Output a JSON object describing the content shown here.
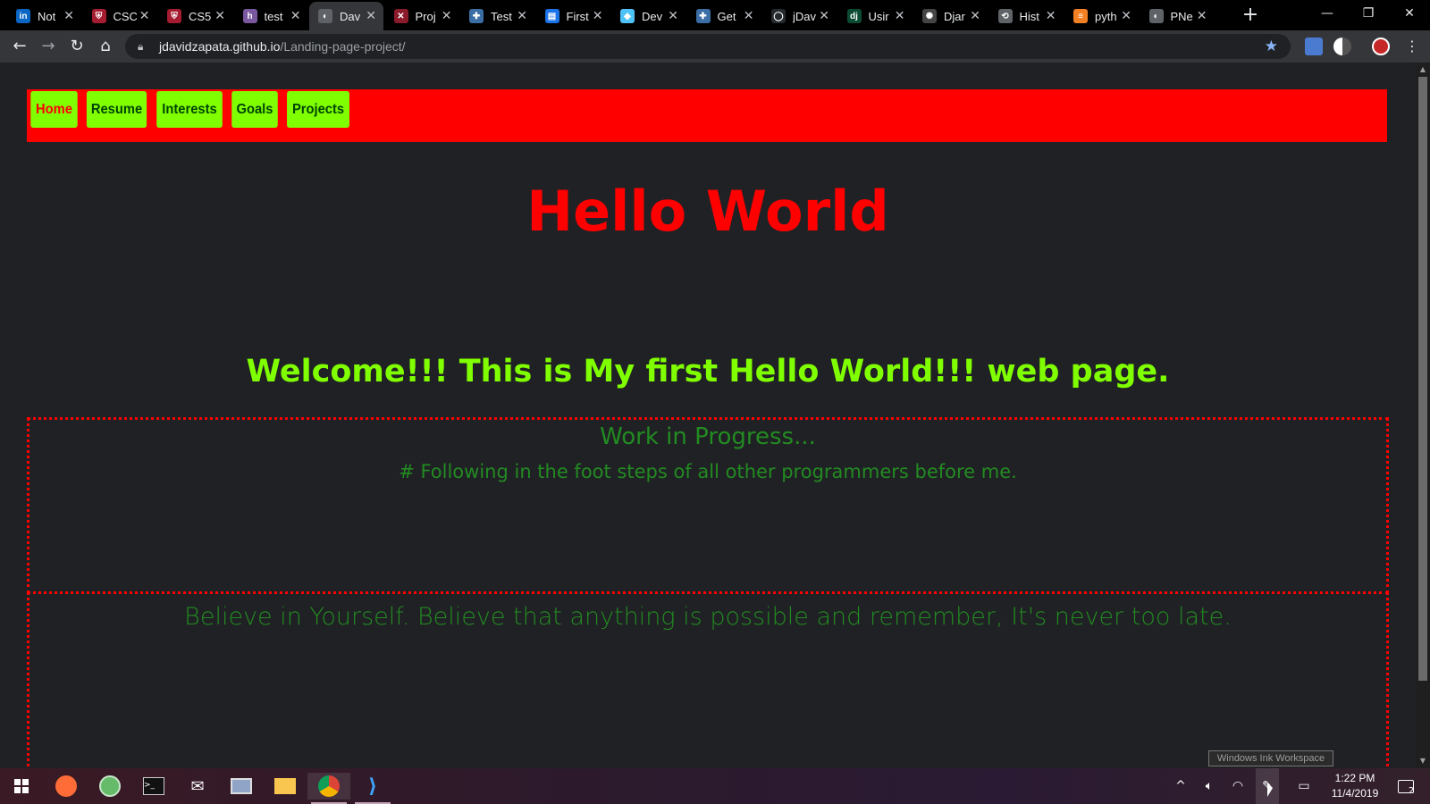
{
  "tabs": [
    {
      "title": "Not",
      "icon": "linkedin-icon",
      "color": "#0a66c2",
      "glyph": "in"
    },
    {
      "title": "CSC",
      "icon": "harvard-shield-icon",
      "color": "#a51c30",
      "glyph": "⛨"
    },
    {
      "title": "CS5",
      "icon": "harvard-shield-icon",
      "color": "#a51c30",
      "glyph": "⛨"
    },
    {
      "title": "test",
      "icon": "heroku-icon",
      "color": "#79589f",
      "glyph": "h"
    },
    {
      "title": "Dav",
      "icon": "globe-icon",
      "color": "#5f6368",
      "glyph": "◐",
      "active": true
    },
    {
      "title": "Proj",
      "icon": "x-logo-icon",
      "color": "#8b1a2b",
      "glyph": "✕"
    },
    {
      "title": "Test",
      "icon": "python-icon",
      "color": "#3a6ea5",
      "glyph": "✚"
    },
    {
      "title": "First",
      "icon": "document-icon",
      "color": "#1a73e8",
      "glyph": "▤"
    },
    {
      "title": "Dev",
      "icon": "cube-icon",
      "color": "#4fc3f7",
      "glyph": "◆"
    },
    {
      "title": "Get",
      "icon": "python-icon",
      "color": "#3a6ea5",
      "glyph": "✚"
    },
    {
      "title": "jDav",
      "icon": "github-icon",
      "color": "#24292e",
      "glyph": "◯"
    },
    {
      "title": "Usir",
      "icon": "django-icon",
      "color": "#0c4b33",
      "glyph": "dj"
    },
    {
      "title": "Djar",
      "icon": "openai-icon",
      "color": "#444",
      "glyph": "✺"
    },
    {
      "title": "Hist",
      "icon": "history-icon",
      "color": "#5f6368",
      "glyph": "⟲"
    },
    {
      "title": "pyth",
      "icon": "stackoverflow-icon",
      "color": "#f48024",
      "glyph": "≡"
    },
    {
      "title": "PNe",
      "icon": "globe-icon",
      "color": "#5f6368",
      "glyph": "◐"
    }
  ],
  "address": {
    "host": "jdavidzapata.github.io",
    "path": "/Landing-page-project/"
  },
  "page": {
    "nav": [
      "Home",
      "Resume",
      "Interests",
      "Goals",
      "Projects"
    ],
    "heading": "Hello World",
    "welcome": "Welcome!!! This is My first Hello World!!! web page.",
    "wip": "Work in Progress...",
    "following": "# Following in the foot steps of all other programmers before me.",
    "quote": "Believe in Yourself. Believe that anything is possible and remember, It's never too late."
  },
  "tooltip": "Windows Ink Workspace",
  "clock": {
    "time": "1:22 PM",
    "date": "11/4/2019"
  },
  "notifications": "2",
  "colors": {
    "nav_bar": "#ff0000",
    "nav_button": "#7fff00",
    "heading": "#ff0000",
    "welcome": "#7fff00",
    "body_text": "#228b22"
  }
}
